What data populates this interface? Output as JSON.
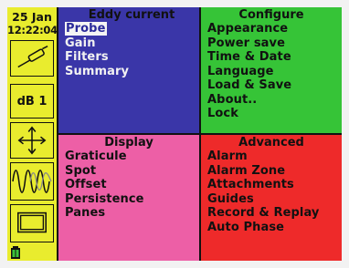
{
  "toolbar": {
    "date": "25 Jan",
    "time": "12:22:04",
    "gain_label": "dB 1",
    "icons": [
      "probe-icon",
      "move-arrows-icon",
      "waveform-icon",
      "pane-layout-icon",
      "battery-icon"
    ]
  },
  "quadrants": {
    "eddy": {
      "title": "Eddy current",
      "color": "#3a36a8",
      "items": [
        "Probe",
        "Gain",
        "Filters",
        "Summary"
      ],
      "selected": "Probe"
    },
    "configure": {
      "title": "Configure",
      "color": "#36c437",
      "items": [
        "Appearance",
        "Power save",
        "Time & Date",
        "Language",
        "Load & Save",
        "About..",
        "Lock"
      ]
    },
    "display": {
      "title": "Display",
      "color": "#ed5fa6",
      "items": [
        "Graticule",
        "Spot",
        "Offset",
        "Persistence",
        "Panes"
      ]
    },
    "advanced": {
      "title": "Advanced",
      "color": "#ee2a2a",
      "items": [
        "Alarm",
        "Alarm Zone",
        "Attachments",
        "Guides",
        "Record & Replay",
        "Auto Phase"
      ]
    }
  },
  "colors": {
    "toolbar": "#e9ec2e",
    "frame": "#111111"
  }
}
